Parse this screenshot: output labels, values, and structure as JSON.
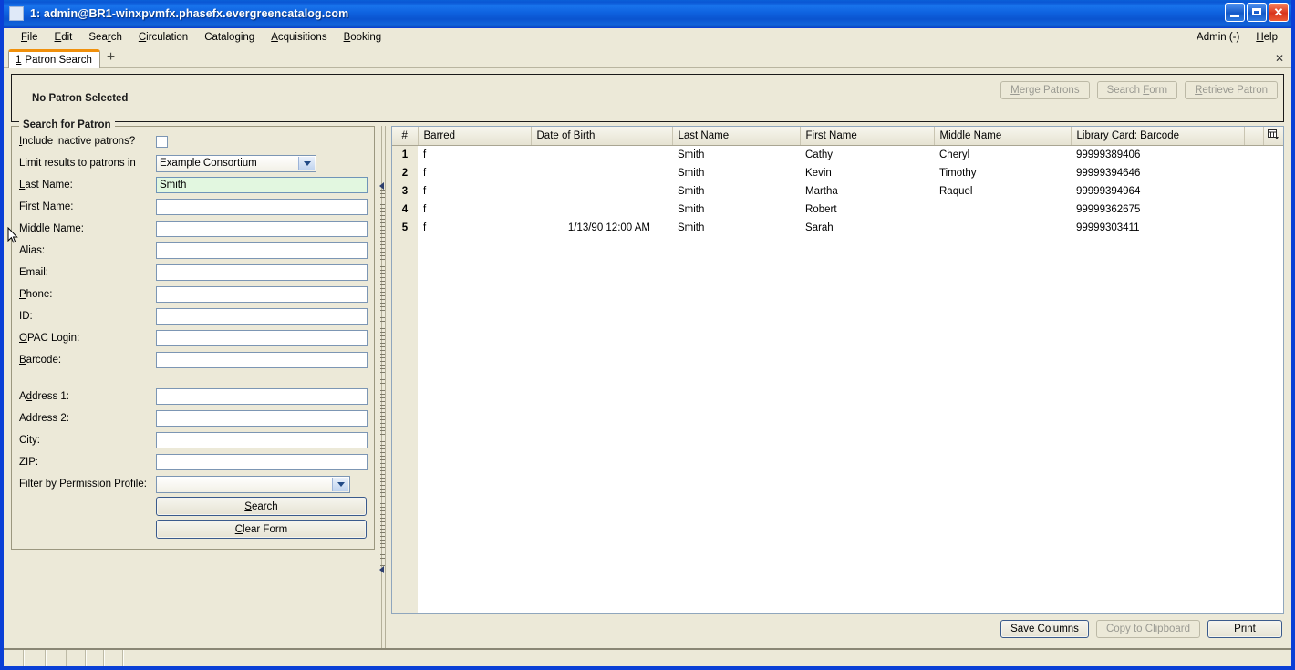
{
  "window": {
    "title": "1: admin@BR1-winxpvmfx.phasefx.evergreencatalog.com",
    "minimize_label": "Minimize",
    "maximize_label": "Maximize",
    "close_label": "✕"
  },
  "menubar": {
    "items": [
      {
        "label": "File",
        "accel": "F"
      },
      {
        "label": "Edit",
        "accel": "E"
      },
      {
        "label": "Search",
        "accel": "r"
      },
      {
        "label": "Circulation",
        "accel": "C"
      },
      {
        "label": "Cataloging",
        "accel": "g"
      },
      {
        "label": "Acquisitions",
        "accel": "A"
      },
      {
        "label": "Booking",
        "accel": "B"
      }
    ],
    "right": [
      {
        "label": "Admin (-)"
      },
      {
        "label": "Help",
        "accel": "H"
      }
    ]
  },
  "tabs": {
    "items": [
      {
        "number": "1",
        "label": "Patron Search"
      }
    ],
    "add_label": "+",
    "close_label": "✕"
  },
  "patron_bar": {
    "title": "No Patron Selected",
    "buttons": [
      {
        "label": "Merge Patrons",
        "enabled": false
      },
      {
        "label": "Search Form",
        "enabled": false
      },
      {
        "label": "Retrieve Patron",
        "enabled": false
      }
    ]
  },
  "search_form": {
    "legend": "Search for Patron",
    "include_inactive_label": "Include inactive patrons?",
    "include_inactive_checked": false,
    "limit_label": "Limit results to patrons in",
    "limit_value": "Example Consortium",
    "fields": [
      {
        "label": "Last Name:",
        "value": "Smith",
        "focused": true
      },
      {
        "label": "First Name:",
        "value": "",
        "focused": false
      },
      {
        "label": "Middle Name:",
        "value": "",
        "focused": false
      },
      {
        "label": "Alias:",
        "value": "",
        "focused": false
      },
      {
        "label": "Email:",
        "value": "",
        "focused": false
      },
      {
        "label": "Phone:",
        "value": "",
        "focused": false
      },
      {
        "label": "ID:",
        "value": "",
        "focused": false
      },
      {
        "label": "OPAC Login:",
        "value": "",
        "focused": false
      },
      {
        "label": "Barcode:",
        "value": "",
        "focused": false
      }
    ],
    "address_fields": [
      {
        "label": "Address 1:",
        "value": ""
      },
      {
        "label": "Address 2:",
        "value": ""
      },
      {
        "label": "City:",
        "value": ""
      },
      {
        "label": "ZIP:",
        "value": ""
      }
    ],
    "permission_label": "Filter by Permission Profile:",
    "permission_value": "",
    "search_button": "Search",
    "clear_button": "Clear Form"
  },
  "results": {
    "columns": [
      "#",
      "Barred",
      "Date of Birth",
      "Last Name",
      "First Name",
      "Middle Name",
      "Library Card: Barcode"
    ],
    "column_picker_icon": "column-picker-icon",
    "rows": [
      {
        "n": "1",
        "barred": "f",
        "dob": "",
        "last": "Smith",
        "first": "Cathy",
        "middle": "Cheryl",
        "barcode": "99999389406"
      },
      {
        "n": "2",
        "barred": "f",
        "dob": "",
        "last": "Smith",
        "first": "Kevin",
        "middle": "Timothy",
        "barcode": "99999394646"
      },
      {
        "n": "3",
        "barred": "f",
        "dob": "",
        "last": "Smith",
        "first": "Martha",
        "middle": "Raquel",
        "barcode": "99999394964"
      },
      {
        "n": "4",
        "barred": "f",
        "dob": "",
        "last": "Smith",
        "first": "Robert",
        "middle": "",
        "barcode": "99999362675"
      },
      {
        "n": "5",
        "barred": "f",
        "dob": "1/13/90 12:00 AM",
        "last": "Smith",
        "first": "Sarah",
        "middle": "",
        "barcode": "99999303411"
      }
    ],
    "toolbar": [
      {
        "label": "Save Columns",
        "enabled": true
      },
      {
        "label": "Copy to Clipboard",
        "enabled": false
      },
      {
        "label": "Print",
        "enabled": true
      }
    ]
  },
  "colors": {
    "title_bar": "#0f63e0",
    "chrome": "#ece9d8",
    "active_tab_accent": "#f0900b",
    "focused_field": "#e2f7e0",
    "border": "#8fa6bd"
  }
}
